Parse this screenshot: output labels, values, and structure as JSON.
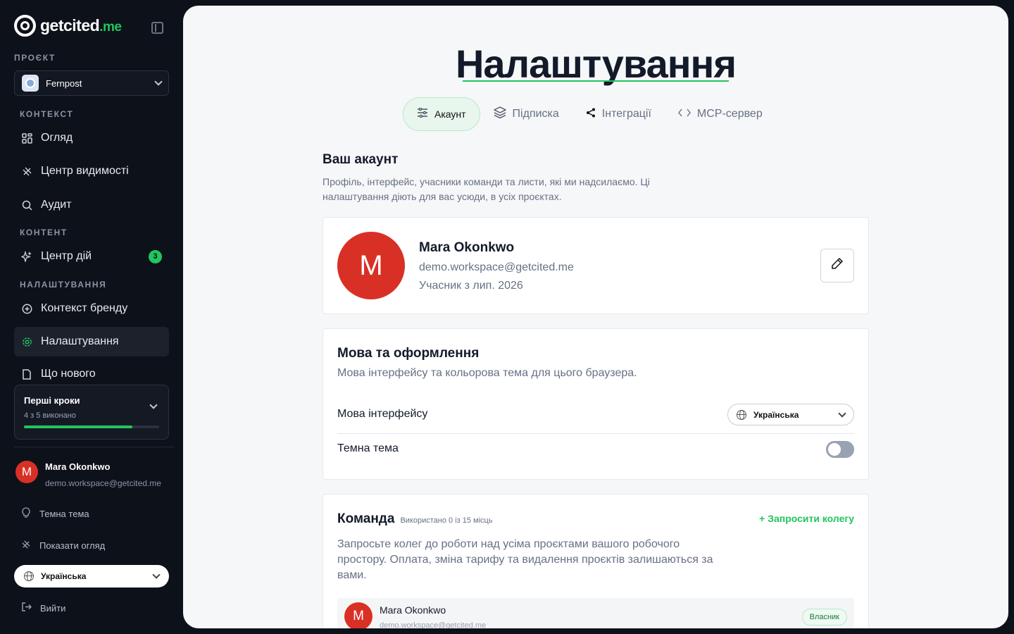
{
  "brand": {
    "name": "getcited",
    "tld": ".me"
  },
  "sidebar": {
    "project_label": "ПРОЄКТ",
    "project_name": "Fernpost",
    "sections": {
      "context": "КОНТЕКСТ",
      "content": "КОНТЕНТ",
      "settings": "НАЛАШТУВАННЯ"
    },
    "items": [
      {
        "label": "Огляд",
        "icon": "grid-icon"
      },
      {
        "label": "Центр видимості",
        "icon": "satellite-icon"
      },
      {
        "label": "Аудит",
        "icon": "search-icon"
      },
      {
        "label": "Центр дій",
        "icon": "sparkles-icon",
        "badge": "3"
      },
      {
        "label": "Контекст бренду",
        "icon": "plus-circle-icon"
      },
      {
        "label": "Налаштування",
        "icon": "gear-icon",
        "active": true
      },
      {
        "label": "Що нового",
        "icon": "document-icon"
      }
    ],
    "onboarding": {
      "title": "Перші кроки",
      "progress_text": "4 з 5 виконано",
      "progress": 0.8
    },
    "user": {
      "initial": "M",
      "name": "Mara Okonkwo",
      "email": "demo.workspace@getcited.me"
    },
    "dark_theme_label": "Темна тема",
    "show_tour_label": "Показати огляд",
    "language": "Українська",
    "logout_label": "Вийти"
  },
  "page": {
    "title": "Налаштування",
    "tabs": [
      {
        "label": "Акаунт",
        "icon": "sliders-icon",
        "active": true
      },
      {
        "label": "Підписка",
        "icon": "layers-icon"
      },
      {
        "label": "Інтеграції",
        "icon": "share-icon"
      },
      {
        "label": "MCP-сервер",
        "icon": "code-icon"
      }
    ]
  },
  "account": {
    "heading": "Ваш акаунт",
    "description": "Профіль, інтерфейс, учасники команди та листи, які ми надсилаємо. Ці налаштування діють для вас усюди, в усіх проєктах.",
    "profile": {
      "initial": "M",
      "name": "Mara Okonkwo",
      "email": "demo.workspace@getcited.me",
      "member_since": "Учасник з лип. 2026"
    }
  },
  "appearance": {
    "title": "Мова та оформлення",
    "subtitle": "Мова інтерфейсу та кольорова тема для цього браузера.",
    "language_label": "Мова інтерфейсу",
    "language_value": "Українська",
    "dark_theme_label": "Темна тема",
    "dark_theme_on": false
  },
  "team": {
    "title": "Команда",
    "used": "Використано 0 із 15 місць",
    "invite_label": "+ Запросити колегу",
    "description": "Запросьте колег до роботи над усіма проєктами вашого робочого простору. Оплата, зміна тарифу та видалення проєктів залишаються за вами.",
    "members": [
      {
        "initial": "M",
        "name": "Mara Okonkwo",
        "email": "demo.workspace@getcited.me",
        "role": "Власник"
      }
    ]
  },
  "colors": {
    "accent": "#22c55e",
    "avatar": "#d93025",
    "sidebar_bg": "#0d111a",
    "main_bg": "#f6f7f8"
  }
}
